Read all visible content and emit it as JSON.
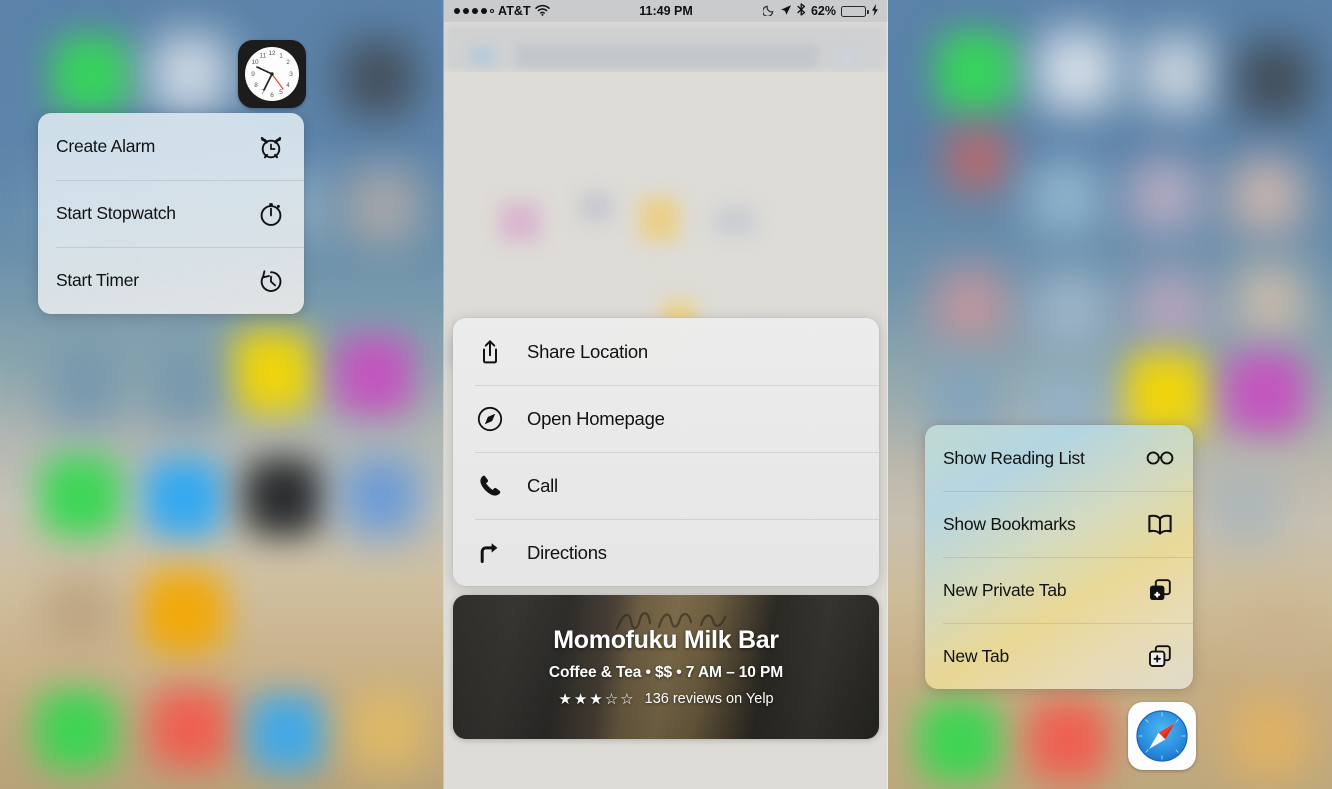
{
  "status_bar": {
    "signal_dots_filled": 4,
    "signal_dots_total": 5,
    "carrier": "AT&T",
    "wifi_icon": "wifi-icon",
    "time": "11:49 PM",
    "do_not_disturb_icon": "moon-icon",
    "location_icon": "location-arrow-icon",
    "bluetooth_icon": "bluetooth-icon",
    "battery_percent": "62%",
    "battery_level": 62,
    "charging_icon": "lightning-bolt-icon",
    "battery_color": "#4cd551"
  },
  "left_panel": {
    "app": "Clock",
    "app_icon": "clock-app-icon",
    "menu": {
      "items": [
        {
          "label": "Create Alarm",
          "icon": "alarm-clock-icon"
        },
        {
          "label": "Start Stopwatch",
          "icon": "stopwatch-icon"
        },
        {
          "label": "Start Timer",
          "icon": "timer-icon"
        }
      ]
    }
  },
  "center_panel": {
    "app": "Safari",
    "menu": {
      "items": [
        {
          "label": "Share Location",
          "icon": "share-icon"
        },
        {
          "label": "Open Homepage",
          "icon": "compass-icon"
        },
        {
          "label": "Call",
          "icon": "phone-icon"
        },
        {
          "label": "Directions",
          "icon": "directions-arrow-icon"
        }
      ]
    },
    "preview_card": {
      "name": "Momofuku Milk Bar",
      "meta": "Coffee & Tea • $$ • 7 AM – 10 PM",
      "stars_filled": 3,
      "stars_total": 5,
      "stars_display": "★★★☆☆",
      "reviews": "136 reviews on Yelp"
    }
  },
  "right_panel": {
    "app": "Safari",
    "app_icon": "safari-app-icon",
    "menu": {
      "items": [
        {
          "label": "Show Reading List",
          "icon": "glasses-icon"
        },
        {
          "label": "Show Bookmarks",
          "icon": "open-book-icon"
        },
        {
          "label": "New Private Tab",
          "icon": "new-private-tab-icon"
        },
        {
          "label": "New Tab",
          "icon": "new-tab-icon"
        }
      ]
    }
  },
  "colors": {
    "accent_battery_green": "#4cd551",
    "menu_text": "#121212",
    "card_overlay_text": "#ffffff",
    "wallpaper_top": "#5b82a8",
    "wallpaper_bottom": "#b8a279"
  }
}
